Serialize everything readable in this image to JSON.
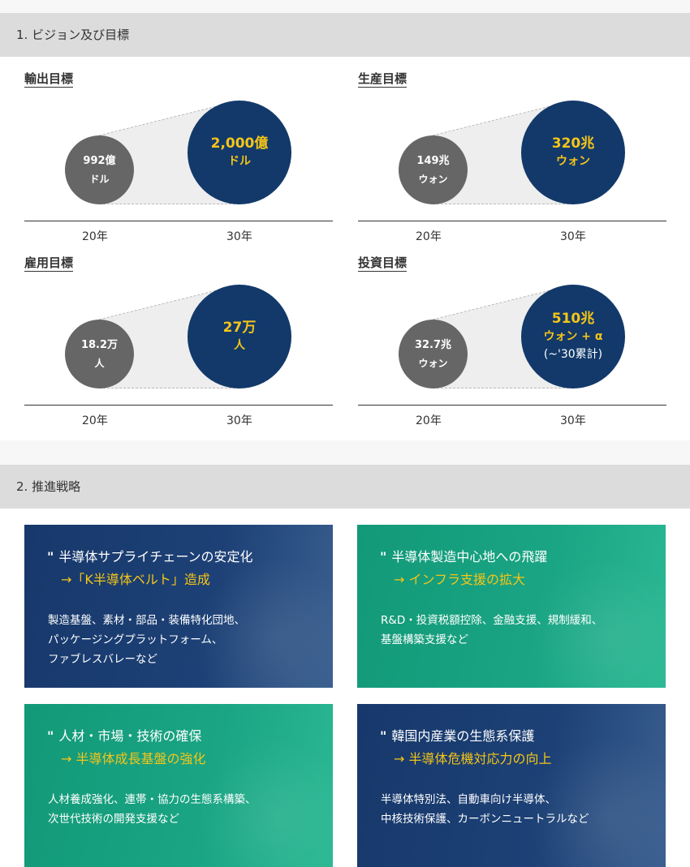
{
  "section1": {
    "title": "1. ビジョン及び目標",
    "goals": [
      {
        "title": "輸出目標",
        "from_value": "992億",
        "from_unit": "ドル",
        "to_value": "2,000億",
        "to_unit": "ドル",
        "from_year": "20年",
        "to_year": "30年"
      },
      {
        "title": "生産目標",
        "from_value": "149兆",
        "from_unit": "ウォン",
        "to_value": "320兆",
        "to_unit": "ウォン",
        "from_year": "20年",
        "to_year": "30年"
      },
      {
        "title": "雇用目標",
        "from_value": "18.2万",
        "from_unit": "人",
        "to_value": "27万",
        "to_unit": "人",
        "from_year": "20年",
        "to_year": "30年"
      },
      {
        "title": "投資目標",
        "from_value": "32.7兆",
        "from_unit": "ウォン",
        "to_value": "510兆",
        "to_unit": "ウォン + α",
        "to_note": "(~'30累計)",
        "from_year": "20年",
        "to_year": "30年"
      }
    ]
  },
  "section2": {
    "title": "2. 推進戦略",
    "quote_mark": "\"",
    "cards": [
      {
        "title": "半導体サプライチェーンの安定化",
        "subtitle": "→「K半導体ベルト」造成",
        "body": [
          "製造基盤、素材・部品・装備特化団地、",
          "パッケージングプラットフォーム、",
          "ファブレスバレーなど"
        ],
        "color": "#17386b"
      },
      {
        "title": "半導体製造中心地への飛躍",
        "subtitle": "→ インフラ支援の拡大",
        "body": [
          "R&D・投資税額控除、金融支援、規制緩和、",
          "基盤構築支援など"
        ],
        "color": "#129978"
      },
      {
        "title": "人材・市場・技術の確保",
        "subtitle": "→ 半導体成長基盤の強化",
        "body": [
          "人材養成強化、連帯・協力の生態系構築、",
          "次世代技術の開発支援など"
        ],
        "color": "#129978"
      },
      {
        "title": "韓国内産業の生態系保護",
        "subtitle": "→ 半導体危機対応力の向上",
        "body": [
          "半導体特別法、自動車向け半導体、",
          "中核技術保護、カーボンニュートラルなど"
        ],
        "color": "#17386b"
      }
    ]
  }
}
